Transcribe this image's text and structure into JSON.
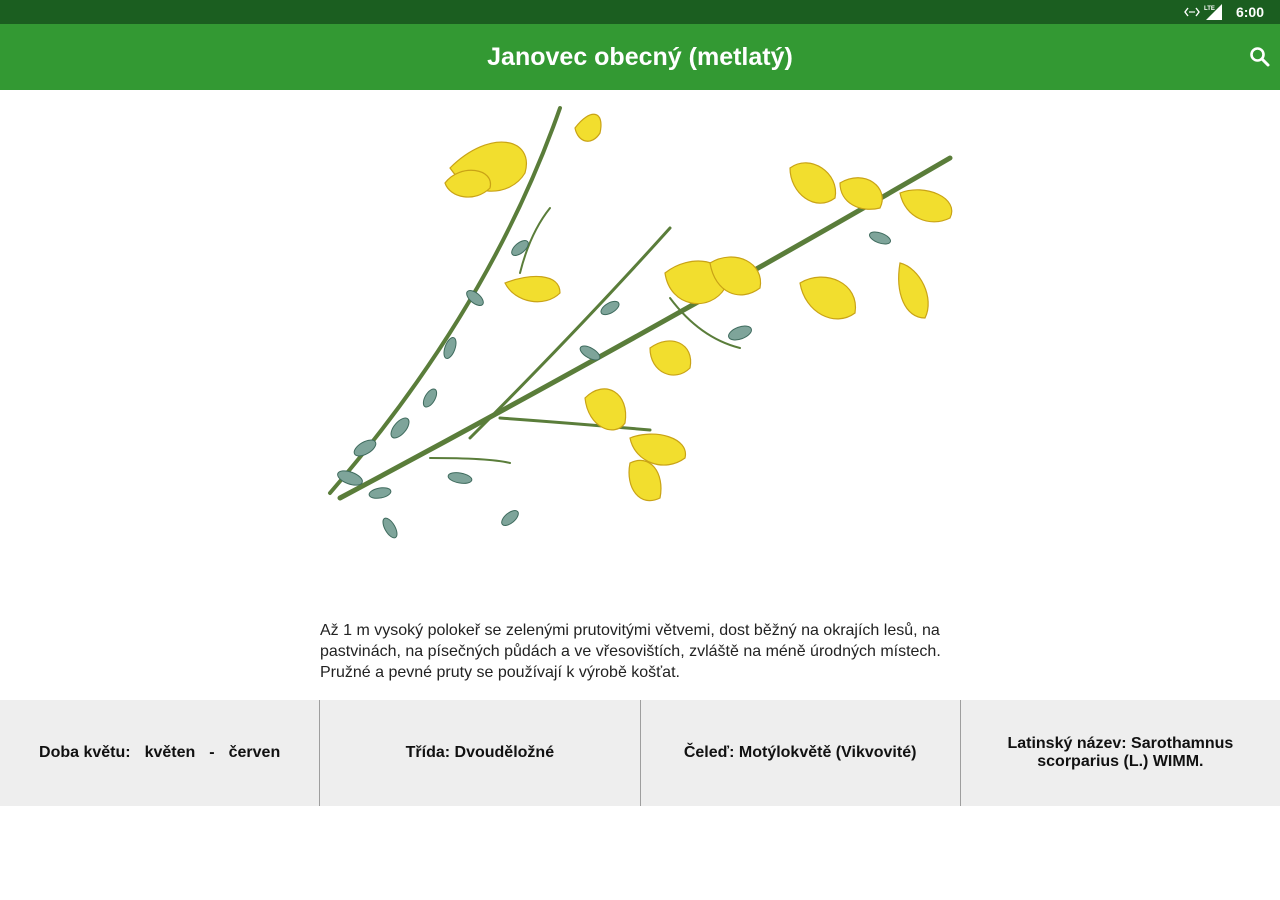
{
  "status_bar": {
    "time": "6:00",
    "icons": [
      "data-transfer-icon",
      "lte-signal-icon"
    ],
    "network_label": "LTE"
  },
  "app_bar": {
    "title": "Janovec obecný (metlatý)",
    "search_icon": "search-icon"
  },
  "plant": {
    "illustration": "broom-plant-illustration",
    "description": "Až 1 m vysoký polokeř se zelenými prutovitými větvemi, dost běžný na okrajích lesů, na pastvinách, na písečných půdách a ve vřesovištích, zvláště na méně úrodných místech. Pružné a pevné pruty se používají k výrobě košťat."
  },
  "info": {
    "bloom_label": "Doba květu:",
    "bloom_from": "květen",
    "bloom_separator": "-",
    "bloom_to": "červen",
    "class": "Třída: Dvouděložné",
    "family": "Čeleď: Motýlokvětě (Vikvovité)",
    "latin": "Latinský název: Sarothamnus scorparius (L.) WIMM."
  },
  "colors": {
    "status_bar": "#1b5e20",
    "app_bar": "#339933",
    "info_strip": "#eeeeee",
    "divider": "#9e9e9e"
  }
}
